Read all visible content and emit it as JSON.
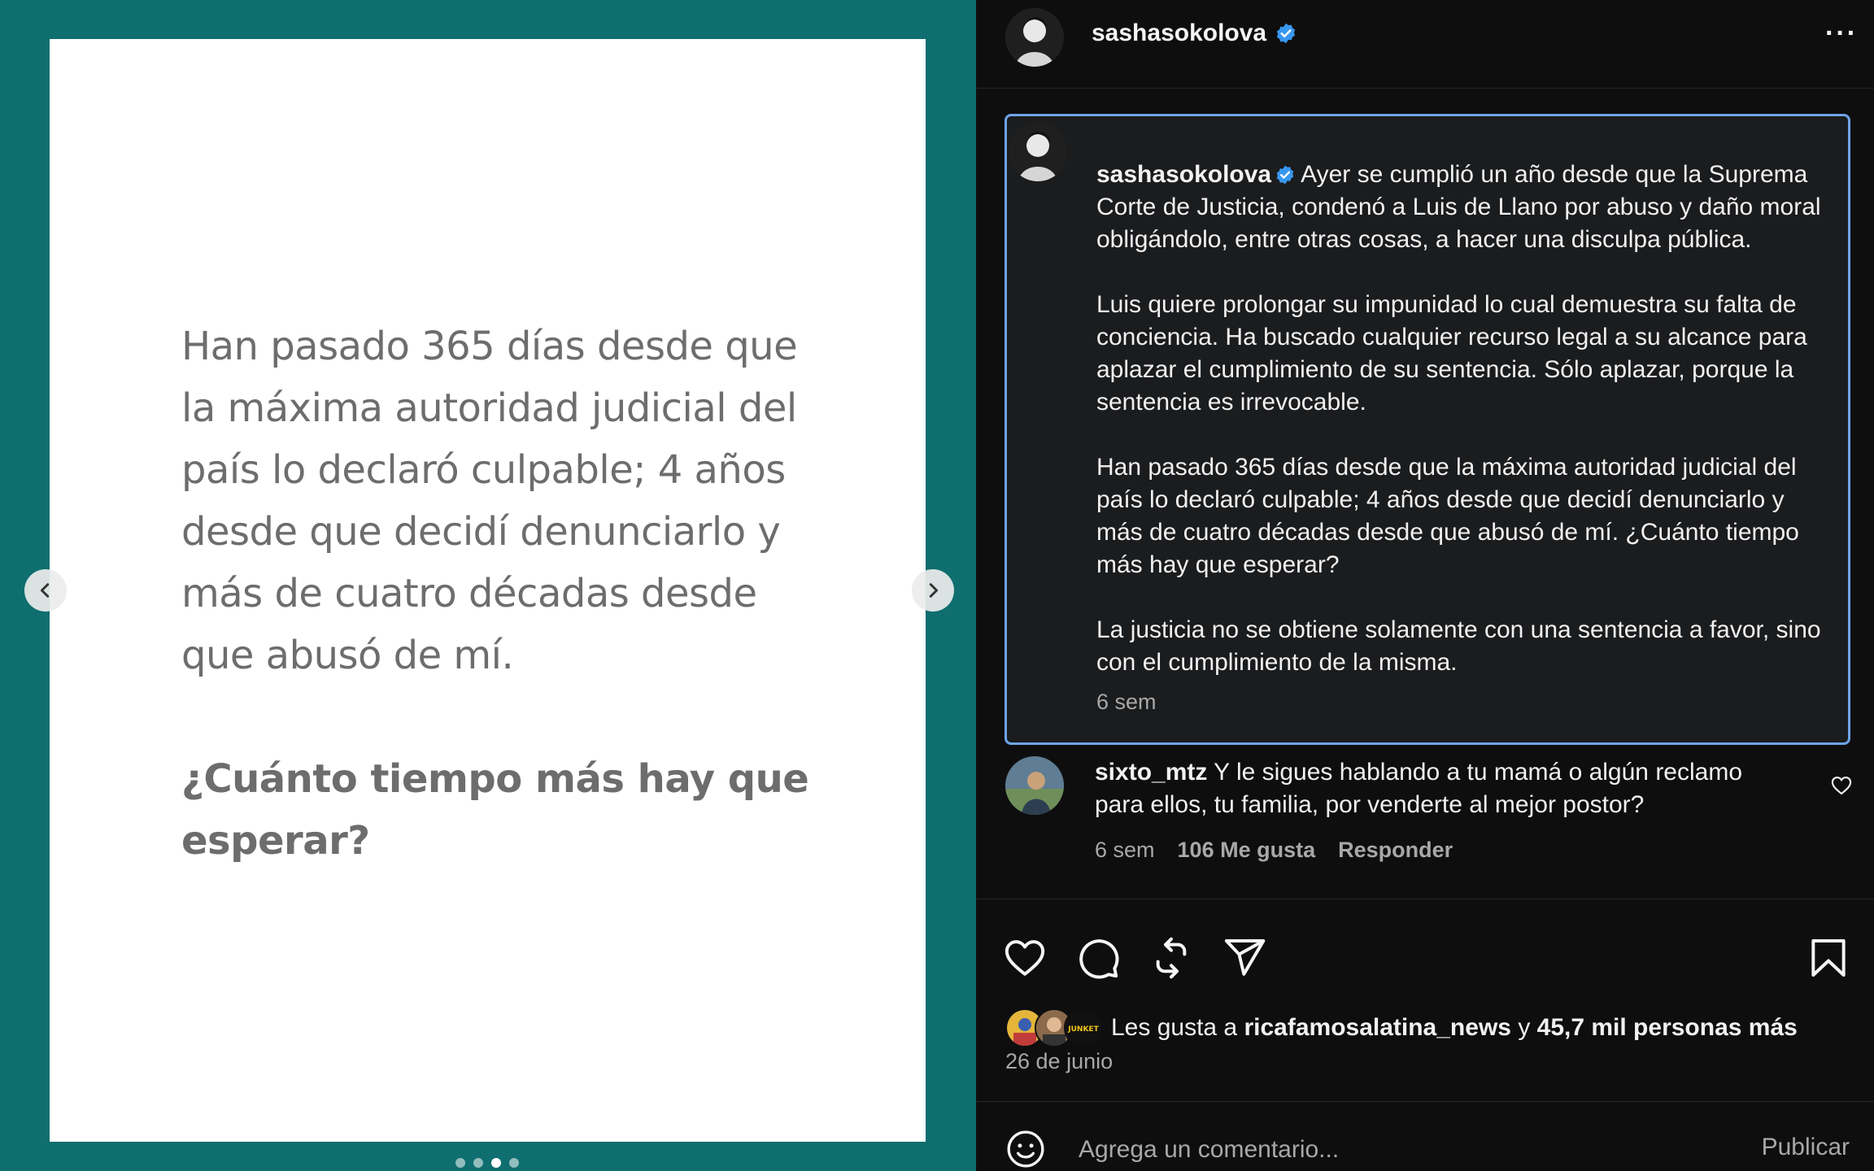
{
  "media": {
    "slide_paragraph": "Han pasado 365 días desde que\nla máxima autoridad judicial del\npaís lo declaró culpable; 4 años\ndesde que decidí denunciarlo y\nmás de cuatro décadas desde\nque abusó de mí.",
    "slide_question": "¿Cuánto tiempo más hay que\nesperar?",
    "prev_icon": "chevron-left-icon",
    "next_icon": "chevron-right-icon",
    "dots_count": 4,
    "active_dot": 2
  },
  "header": {
    "username": "sashasokolova",
    "verified_icon": "verified-badge-icon",
    "more_label": "···"
  },
  "caption": {
    "username": "sashasokolova",
    "paragraphs": [
      "Ayer se cumplió un año desde que la Suprema Corte de Justicia, condenó a Luis de Llano por abuso y daño moral obligándolo, entre otras cosas, a hacer una disculpa pública.",
      "Luis quiere prolongar su impunidad lo cual demuestra su falta de conciencia. Ha buscado cualquier recurso legal a su alcance para aplazar el cumplimiento de su sentencia. Sólo aplazar, porque la sentencia es irrevocable.",
      "Han pasado 365 días desde que la máxima autoridad judicial del país lo declaró culpable; 4 años desde que decidí denunciarlo y más de cuatro décadas desde que abusó de mí. ¿Cuánto tiempo más hay que esperar?",
      "La justicia no se obtiene solamente con una sentencia a favor, sino con el cumplimiento de la misma."
    ],
    "time": "6 sem"
  },
  "comment": {
    "username": "sixto_mtz",
    "text": "Y le sigues hablando a tu mamá o algún reclamo\npara ellos, tu familia, por venderte al mejor postor?",
    "time": "6 sem",
    "likes": "106 Me gusta",
    "reply": "Responder"
  },
  "actions": {
    "like_icon": "heart-icon",
    "comment_icon": "comment-icon",
    "repost_icon": "repost-icon",
    "share_icon": "share-icon",
    "save_icon": "bookmark-icon"
  },
  "likes": {
    "prefix": "Les gusta a",
    "user": "ricafamosalatina_news",
    "middle": "y",
    "others": "45,7 mil personas más",
    "mini_avatar_label": "JUNKET"
  },
  "date": "26 de junio",
  "composer": {
    "placeholder": "Agrega un comentario...",
    "publish_label": "Publicar"
  },
  "colors": {
    "teal_background": "#0f6e6f",
    "panel_background": "#0e0e0f",
    "caption_highlight_border": "#6ea4e8",
    "verified_blue": "#3897f0"
  }
}
